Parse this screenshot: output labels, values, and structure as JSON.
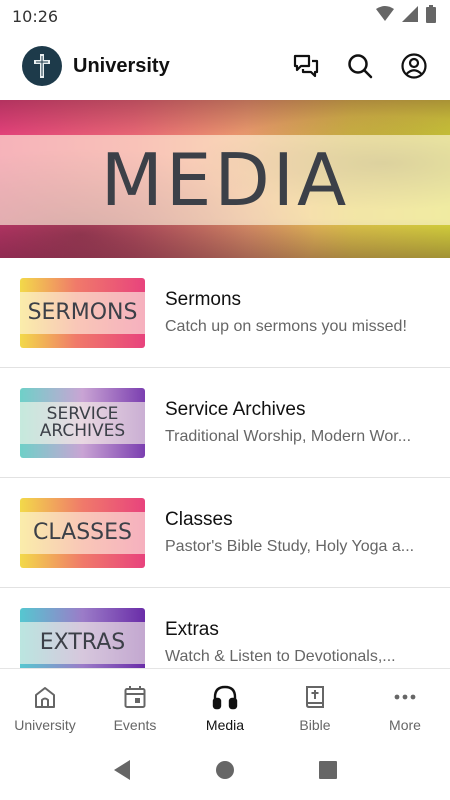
{
  "status_bar": {
    "time": "10:26"
  },
  "header": {
    "title": "University"
  },
  "hero": {
    "title": "MEDIA"
  },
  "items": [
    {
      "thumb_label": "SERMONS",
      "title": "Sermons",
      "subtitle": "Catch up on sermons you missed!"
    },
    {
      "thumb_label": "SERVICE ARCHIVES",
      "title": "Service Archives",
      "subtitle": "Traditional Worship, Modern Wor..."
    },
    {
      "thumb_label": "CLASSES",
      "title": "Classes",
      "subtitle": "Pastor's Bible Study, Holy Yoga a..."
    },
    {
      "thumb_label": "EXTRAS",
      "title": "Extras",
      "subtitle": "Watch & Listen to Devotionals,..."
    }
  ],
  "bottom_nav": [
    {
      "label": "University",
      "icon": "home-icon"
    },
    {
      "label": "Events",
      "icon": "calendar-icon"
    },
    {
      "label": "Media",
      "icon": "headphones-icon",
      "active": true
    },
    {
      "label": "Bible",
      "icon": "bible-icon"
    },
    {
      "label": "More",
      "icon": "more-icon"
    }
  ],
  "colors": {
    "logo_bg": "#1d3a4a",
    "hero_pink": "#e8437d",
    "hero_yellow": "#d8d63c",
    "text_dark": "#3c4048"
  }
}
